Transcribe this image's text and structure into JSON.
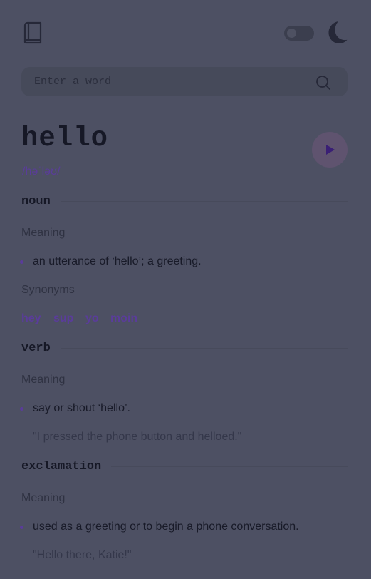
{
  "header": {
    "logo_icon": "book-icon",
    "theme_toggle_icon": "moon-icon",
    "theme_toggle_state": "off"
  },
  "search": {
    "placeholder": "Enter a word",
    "value": ""
  },
  "entry": {
    "word": "hello",
    "phonetic": "/həˈləʊ/",
    "play_icon": "play-icon",
    "accent_color": "#5a3c9a"
  },
  "meanings": [
    {
      "part_of_speech": "noun",
      "meaning_label": "Meaning",
      "definitions": [
        {
          "text": "an utterance of ‘hello’; a greeting."
        }
      ],
      "synonyms_label": "Synonyms",
      "synonyms": [
        "hey",
        "sup",
        "yo",
        "moin"
      ]
    },
    {
      "part_of_speech": "verb",
      "meaning_label": "Meaning",
      "definitions": [
        {
          "text": "say or shout ‘hello’.",
          "example": "\"I pressed the phone button and helloed.\""
        }
      ]
    },
    {
      "part_of_speech": "exclamation",
      "meaning_label": "Meaning",
      "definitions": [
        {
          "text": "used as a greeting or to begin a phone conversation.",
          "example": "\"Hello there, Katie!\""
        }
      ]
    }
  ]
}
